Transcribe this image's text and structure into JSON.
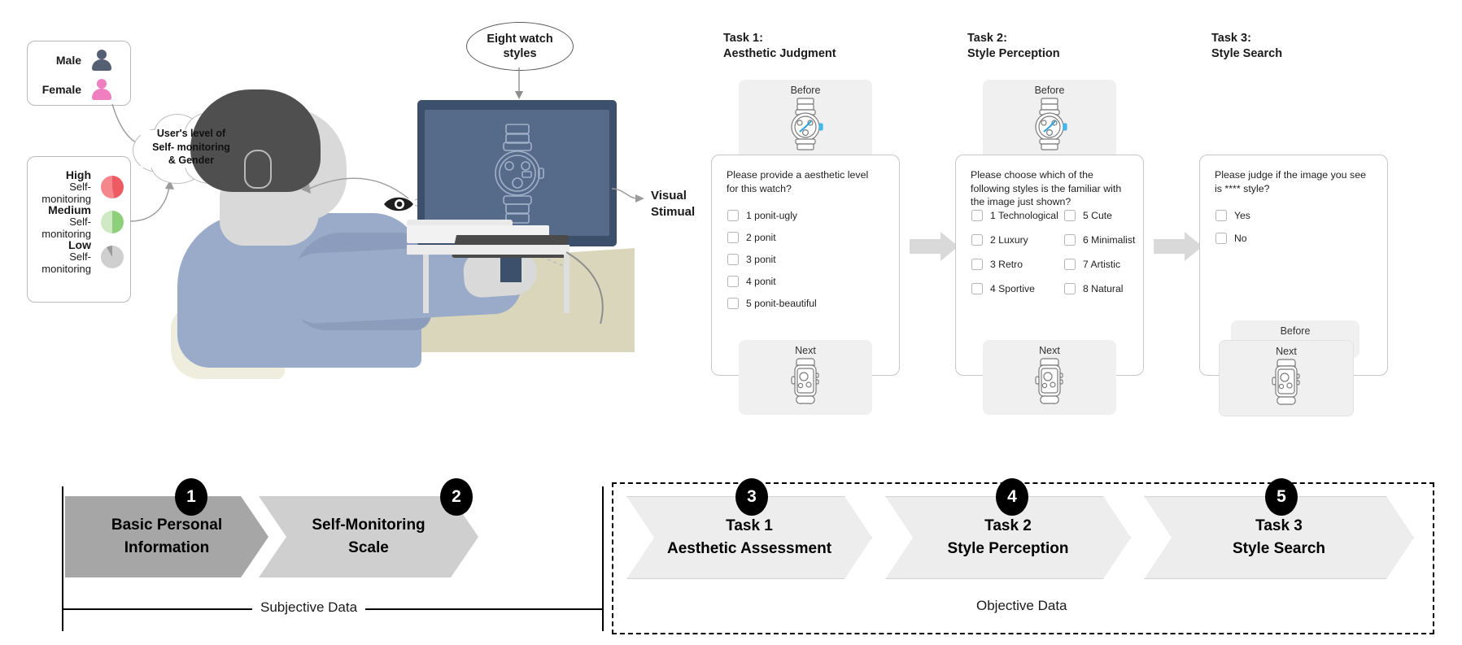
{
  "legend": {
    "gender": {
      "items": [
        {
          "label": "Male",
          "icon": "person-icon",
          "color": "#555f72"
        },
        {
          "label": "Female",
          "icon": "person-icon",
          "color": "#f07fc0"
        }
      ]
    },
    "self_monitoring": {
      "items": [
        {
          "level": "High",
          "sub": "Self- monitoring",
          "icon": "pie-icon",
          "color": "#ef5b63"
        },
        {
          "level": "Medium",
          "sub": "Self- monitoring",
          "icon": "pie-icon",
          "color": "#8ed07a"
        },
        {
          "level": "Low",
          "sub": "Self- monitoring",
          "icon": "pie-icon",
          "color": "#cfcfcf"
        }
      ]
    }
  },
  "cloud": {
    "line1": "User's level of",
    "line2": "Self- monitoring",
    "line3": "& Gender"
  },
  "callout": {
    "line1": "Eight watch",
    "line2": "styles"
  },
  "stimulus_label": {
    "line1": "Visual",
    "line2": "Stimual"
  },
  "tasks": [
    {
      "title_line1": "Task 1:",
      "title_line2": "Aesthetic Judgment",
      "before_caption": "Before",
      "next_caption": "Next",
      "question": "Please provide a aesthetic level for this watch?",
      "columns": 1,
      "options": [
        "1 ponit-ugly",
        "2 ponit",
        "3 ponit",
        "4 ponit",
        "5 ponit-beautiful"
      ]
    },
    {
      "title_line1": "Task 2:",
      "title_line2": "Style Perception",
      "before_caption": "Before",
      "next_caption": "Next",
      "question": "Please choose which of the following styles is the familiar with the image just shown?",
      "columns": 2,
      "options_left": [
        "1 Technological",
        "2 Luxury",
        "3 Retro",
        "4 Sportive"
      ],
      "options_right": [
        "5 Cute",
        "6 Minimalist",
        "7 Artistic",
        "8 Natural"
      ]
    },
    {
      "title_line1": "Task 3:",
      "title_line2": "Style Search",
      "before_caption": "Before",
      "next_caption": "Next",
      "question": "Please judge if the image you see is ****  style?",
      "columns": 1,
      "options": [
        "Yes",
        "No"
      ]
    }
  ],
  "flow": {
    "steps": [
      {
        "num": "1",
        "line1": "Basic Personal",
        "line2": "Information",
        "fill": "#a6a6a6"
      },
      {
        "num": "2",
        "line1": "Self-Monitoring",
        "line2": "Scale",
        "fill": "#cfcfcf"
      },
      {
        "num": "3",
        "line1": "Task 1",
        "line2": "Aesthetic Assessment",
        "fill": "#ededed"
      },
      {
        "num": "4",
        "line1": "Task 2",
        "line2": "Style Perception",
        "fill": "#ededed"
      },
      {
        "num": "5",
        "line1": "Task 3",
        "line2": "Style Search",
        "fill": "#ededed"
      }
    ],
    "group_left_label": "Subjective Data",
    "group_right_label": "Objective Data"
  }
}
